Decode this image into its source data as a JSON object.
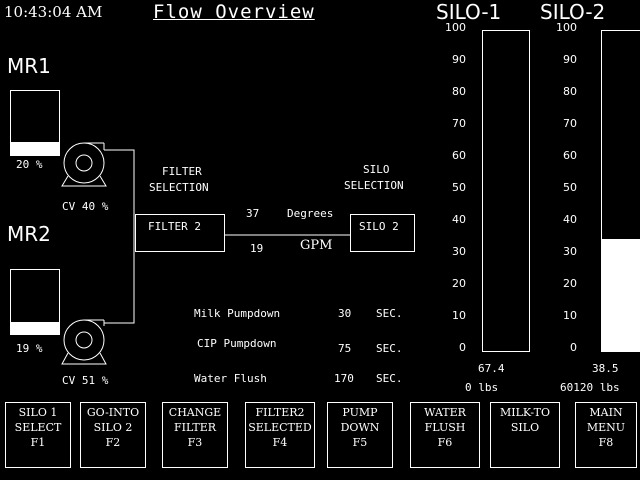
{
  "header": {
    "time": "10:43:04 AM",
    "title": "Flow Overview"
  },
  "mr1": {
    "label": "MR1",
    "level_percent": 20,
    "level_text": "20 %",
    "cv_text": "CV 40 %"
  },
  "mr2": {
    "label": "MR2",
    "level_percent": 19,
    "level_text": "19 %",
    "cv_text": "CV 51 %"
  },
  "filter": {
    "heading_line1": "FILTER",
    "heading_line2": "SELECTION",
    "selected": "FILTER 2"
  },
  "silo_select": {
    "heading_line1": "SILO",
    "heading_line2": "SELECTION",
    "selected": "SILO 2"
  },
  "flow": {
    "temp_value": "37",
    "temp_unit": "Degrees",
    "rate_value": "19",
    "rate_unit": "GPM"
  },
  "timers": [
    {
      "label": "Milk Pumpdown",
      "value": "30",
      "unit": "SEC."
    },
    {
      "label": "CIP Pumpdown",
      "value": "75",
      "unit": "SEC."
    },
    {
      "label": "Water Flush",
      "value": "170",
      "unit": "SEC."
    }
  ],
  "silo1": {
    "label": "SILO-1",
    "level_percent": 0,
    "level_text": "67.4",
    "weight_text": "0 lbs"
  },
  "silo2": {
    "label": "SILO-2",
    "level_percent": 35,
    "level_text": "38.5",
    "weight_text": "60120 lbs"
  },
  "scale_ticks": [
    "100",
    "90",
    "80",
    "70",
    "60",
    "50",
    "40",
    "30",
    "20",
    "10",
    "0"
  ],
  "fkeys": [
    {
      "line1": "SILO 1",
      "line2": "SELECT",
      "line3": "F1"
    },
    {
      "line1": "GO-INTO",
      "line2": "SILO 2",
      "line3": "F2"
    },
    {
      "line1": "CHANGE",
      "line2": "FILTER",
      "line3": "F3"
    },
    {
      "line1": "FILTER2",
      "line2": "SELECTED",
      "line3": "F4"
    },
    {
      "line1": "PUMP",
      "line2": "DOWN",
      "line3": "F5"
    },
    {
      "line1": "WATER",
      "line2": "FLUSH",
      "line3": "F6"
    },
    {
      "line1": "MILK-TO",
      "line2": "SILO",
      "line3": ""
    },
    {
      "line1": "MAIN",
      "line2": "MENU",
      "line3": "F8"
    }
  ],
  "colors": {
    "background": "#000000",
    "foreground": "#ffffff"
  }
}
